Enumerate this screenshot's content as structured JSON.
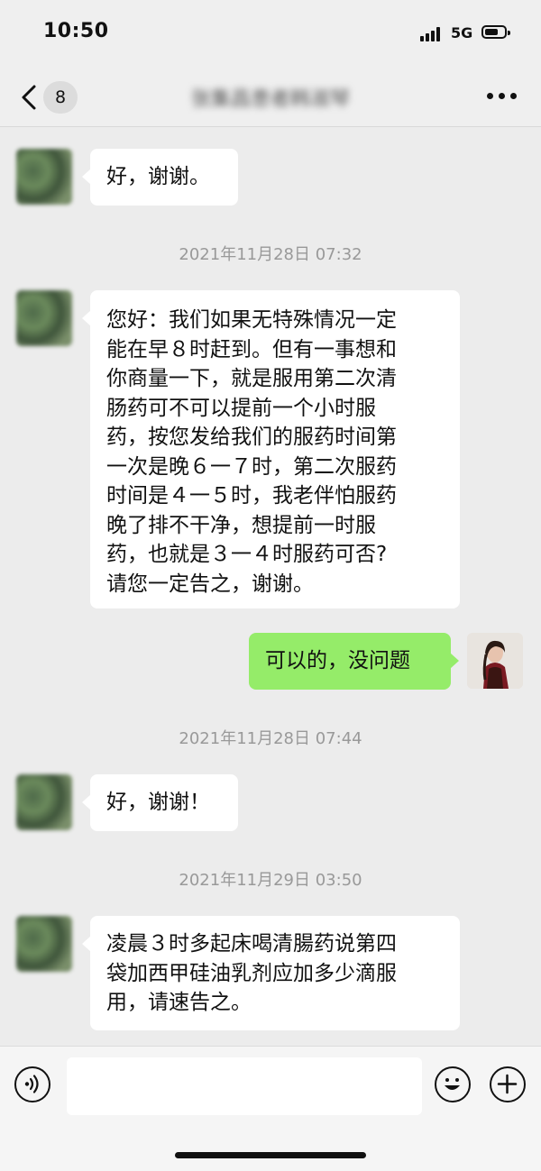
{
  "status_bar": {
    "time": "10:50",
    "network": "5G",
    "battery_level": 0.72
  },
  "nav": {
    "unread_count": "8",
    "title": "张集昌患者韩淑琴"
  },
  "messages": [
    {
      "sender": "other",
      "text": "好，谢谢。"
    },
    {
      "type": "timestamp",
      "text": "2021年11月28日 07:32"
    },
    {
      "sender": "other",
      "lines": [
        "您好：我们如果无特殊情况一定",
        "能在早８时赶到。但有一事想和",
        "你商量一下，就是服用第二次清",
        "肠药可不可以提前一个小时服",
        "药，按您发给我们的服药时间第",
        "一次是晚６一７时，第二次服药",
        "时间是４一５时，我老伴怕服药",
        "晚了排不干净，想提前一时服",
        "药，也就是３一４时服药可否?",
        "请您一定告之，谢谢。"
      ]
    },
    {
      "sender": "self",
      "text": "可以的，没问题"
    },
    {
      "type": "timestamp",
      "text": "2021年11月28日 07:44"
    },
    {
      "sender": "other",
      "text": "好，谢谢！"
    },
    {
      "type": "timestamp",
      "text": "2021年11月29日 03:50"
    },
    {
      "sender": "other",
      "lines": [
        "凌晨３时多起床喝清腸药说第四",
        "袋加西甲硅油乳剂应加多少滴服",
        "用，请速告之。"
      ]
    }
  ],
  "input_bar": {
    "text_value": ""
  },
  "colors": {
    "background": "#ececec",
    "self_bubble": "#95ec69",
    "other_bubble": "#ffffff",
    "timestamp_text": "#999999"
  },
  "icons": [
    "back-chevron-icon",
    "more-dots-icon",
    "voice-icon",
    "emoji-icon",
    "plus-icon"
  ]
}
